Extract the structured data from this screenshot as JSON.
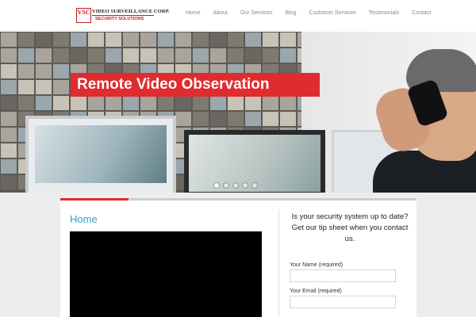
{
  "logo": {
    "mark": "VSC",
    "line1": "VIDEO SURVEILLANCE CORP.",
    "line2": "SECURITY SOLUTIONS"
  },
  "nav": {
    "items": [
      "Home",
      "About",
      "Our Services",
      "Blog",
      "Customer Services",
      "Testimonials",
      "Contact"
    ]
  },
  "hero": {
    "banner": "Remote Video Observation",
    "slide_count": 5,
    "active_slide": 1
  },
  "main": {
    "title": "Home"
  },
  "sidebar": {
    "promo_line1": "Is your security system up to date?",
    "promo_line2": "Get our tip sheet when you contact us.",
    "name_label": "Your Name (required)",
    "email_label": "Your Email (required)"
  },
  "colors": {
    "accent_red": "#e02b2f",
    "title_blue": "#2aa3c2"
  }
}
